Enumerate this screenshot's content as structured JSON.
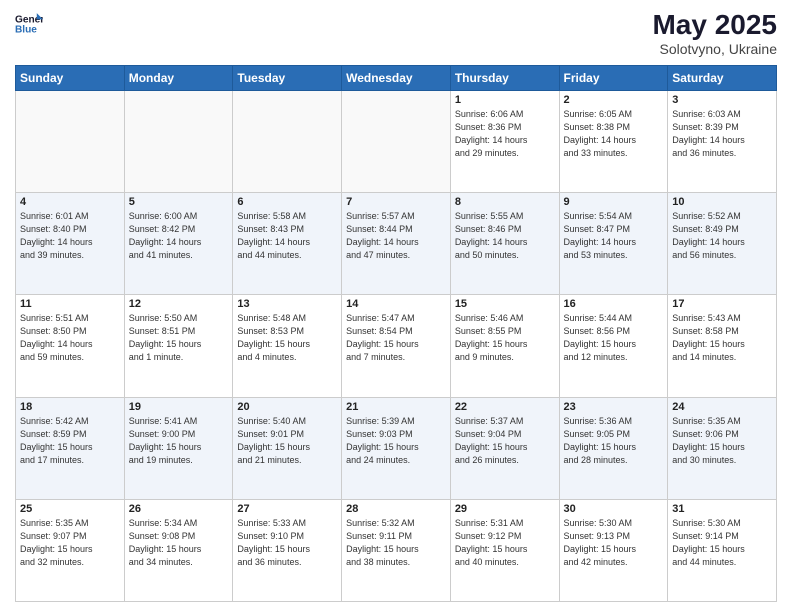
{
  "header": {
    "logo_text_general": "General",
    "logo_text_blue": "Blue",
    "main_title": "May 2025",
    "subtitle": "Solotvyno, Ukraine"
  },
  "weekdays": [
    "Sunday",
    "Monday",
    "Tuesday",
    "Wednesday",
    "Thursday",
    "Friday",
    "Saturday"
  ],
  "weeks": [
    [
      {
        "day": "",
        "info": ""
      },
      {
        "day": "",
        "info": ""
      },
      {
        "day": "",
        "info": ""
      },
      {
        "day": "",
        "info": ""
      },
      {
        "day": "1",
        "info": "Sunrise: 6:06 AM\nSunset: 8:36 PM\nDaylight: 14 hours\nand 29 minutes."
      },
      {
        "day": "2",
        "info": "Sunrise: 6:05 AM\nSunset: 8:38 PM\nDaylight: 14 hours\nand 33 minutes."
      },
      {
        "day": "3",
        "info": "Sunrise: 6:03 AM\nSunset: 8:39 PM\nDaylight: 14 hours\nand 36 minutes."
      }
    ],
    [
      {
        "day": "4",
        "info": "Sunrise: 6:01 AM\nSunset: 8:40 PM\nDaylight: 14 hours\nand 39 minutes."
      },
      {
        "day": "5",
        "info": "Sunrise: 6:00 AM\nSunset: 8:42 PM\nDaylight: 14 hours\nand 41 minutes."
      },
      {
        "day": "6",
        "info": "Sunrise: 5:58 AM\nSunset: 8:43 PM\nDaylight: 14 hours\nand 44 minutes."
      },
      {
        "day": "7",
        "info": "Sunrise: 5:57 AM\nSunset: 8:44 PM\nDaylight: 14 hours\nand 47 minutes."
      },
      {
        "day": "8",
        "info": "Sunrise: 5:55 AM\nSunset: 8:46 PM\nDaylight: 14 hours\nand 50 minutes."
      },
      {
        "day": "9",
        "info": "Sunrise: 5:54 AM\nSunset: 8:47 PM\nDaylight: 14 hours\nand 53 minutes."
      },
      {
        "day": "10",
        "info": "Sunrise: 5:52 AM\nSunset: 8:49 PM\nDaylight: 14 hours\nand 56 minutes."
      }
    ],
    [
      {
        "day": "11",
        "info": "Sunrise: 5:51 AM\nSunset: 8:50 PM\nDaylight: 14 hours\nand 59 minutes."
      },
      {
        "day": "12",
        "info": "Sunrise: 5:50 AM\nSunset: 8:51 PM\nDaylight: 15 hours\nand 1 minute."
      },
      {
        "day": "13",
        "info": "Sunrise: 5:48 AM\nSunset: 8:53 PM\nDaylight: 15 hours\nand 4 minutes."
      },
      {
        "day": "14",
        "info": "Sunrise: 5:47 AM\nSunset: 8:54 PM\nDaylight: 15 hours\nand 7 minutes."
      },
      {
        "day": "15",
        "info": "Sunrise: 5:46 AM\nSunset: 8:55 PM\nDaylight: 15 hours\nand 9 minutes."
      },
      {
        "day": "16",
        "info": "Sunrise: 5:44 AM\nSunset: 8:56 PM\nDaylight: 15 hours\nand 12 minutes."
      },
      {
        "day": "17",
        "info": "Sunrise: 5:43 AM\nSunset: 8:58 PM\nDaylight: 15 hours\nand 14 minutes."
      }
    ],
    [
      {
        "day": "18",
        "info": "Sunrise: 5:42 AM\nSunset: 8:59 PM\nDaylight: 15 hours\nand 17 minutes."
      },
      {
        "day": "19",
        "info": "Sunrise: 5:41 AM\nSunset: 9:00 PM\nDaylight: 15 hours\nand 19 minutes."
      },
      {
        "day": "20",
        "info": "Sunrise: 5:40 AM\nSunset: 9:01 PM\nDaylight: 15 hours\nand 21 minutes."
      },
      {
        "day": "21",
        "info": "Sunrise: 5:39 AM\nSunset: 9:03 PM\nDaylight: 15 hours\nand 24 minutes."
      },
      {
        "day": "22",
        "info": "Sunrise: 5:37 AM\nSunset: 9:04 PM\nDaylight: 15 hours\nand 26 minutes."
      },
      {
        "day": "23",
        "info": "Sunrise: 5:36 AM\nSunset: 9:05 PM\nDaylight: 15 hours\nand 28 minutes."
      },
      {
        "day": "24",
        "info": "Sunrise: 5:35 AM\nSunset: 9:06 PM\nDaylight: 15 hours\nand 30 minutes."
      }
    ],
    [
      {
        "day": "25",
        "info": "Sunrise: 5:35 AM\nSunset: 9:07 PM\nDaylight: 15 hours\nand 32 minutes."
      },
      {
        "day": "26",
        "info": "Sunrise: 5:34 AM\nSunset: 9:08 PM\nDaylight: 15 hours\nand 34 minutes."
      },
      {
        "day": "27",
        "info": "Sunrise: 5:33 AM\nSunset: 9:10 PM\nDaylight: 15 hours\nand 36 minutes."
      },
      {
        "day": "28",
        "info": "Sunrise: 5:32 AM\nSunset: 9:11 PM\nDaylight: 15 hours\nand 38 minutes."
      },
      {
        "day": "29",
        "info": "Sunrise: 5:31 AM\nSunset: 9:12 PM\nDaylight: 15 hours\nand 40 minutes."
      },
      {
        "day": "30",
        "info": "Sunrise: 5:30 AM\nSunset: 9:13 PM\nDaylight: 15 hours\nand 42 minutes."
      },
      {
        "day": "31",
        "info": "Sunrise: 5:30 AM\nSunset: 9:14 PM\nDaylight: 15 hours\nand 44 minutes."
      }
    ]
  ]
}
